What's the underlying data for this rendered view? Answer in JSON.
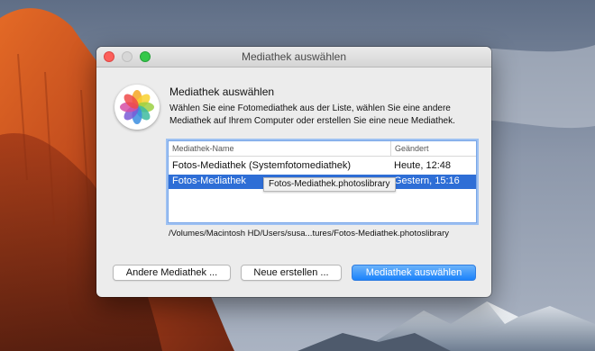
{
  "window": {
    "title": "Mediathek auswählen"
  },
  "dialog": {
    "heading": "Mediathek auswählen",
    "description": "Wählen Sie eine Fotomediathek aus der Liste, wählen Sie eine andere Mediathek auf Ihrem Computer oder erstellen Sie eine neue Mediathek."
  },
  "table": {
    "columns": [
      "Mediathek-Name",
      "Geändert"
    ],
    "rows": [
      {
        "name": "Fotos-Mediathek (Systemfotomediathek)",
        "date": "Heute, 12:48"
      },
      {
        "name": "Fotos-Mediathek",
        "date": "Gestern, 15:16"
      }
    ],
    "tooltip": "Fotos-Mediathek.photoslibrary"
  },
  "path": "/Volumes/Macintosh HD/Users/susa...tures/Fotos-Mediathek.photoslibrary",
  "buttons": {
    "other": "Andere Mediathek ...",
    "new": "Neue erstellen ...",
    "choose": "Mediathek auswählen"
  },
  "colors": {
    "accent": "#2e6ed6",
    "primary_button": "#1a82fb",
    "close": "#fc605b",
    "zoom": "#34c84a"
  },
  "icons": {
    "app": "photos-app-icon"
  }
}
